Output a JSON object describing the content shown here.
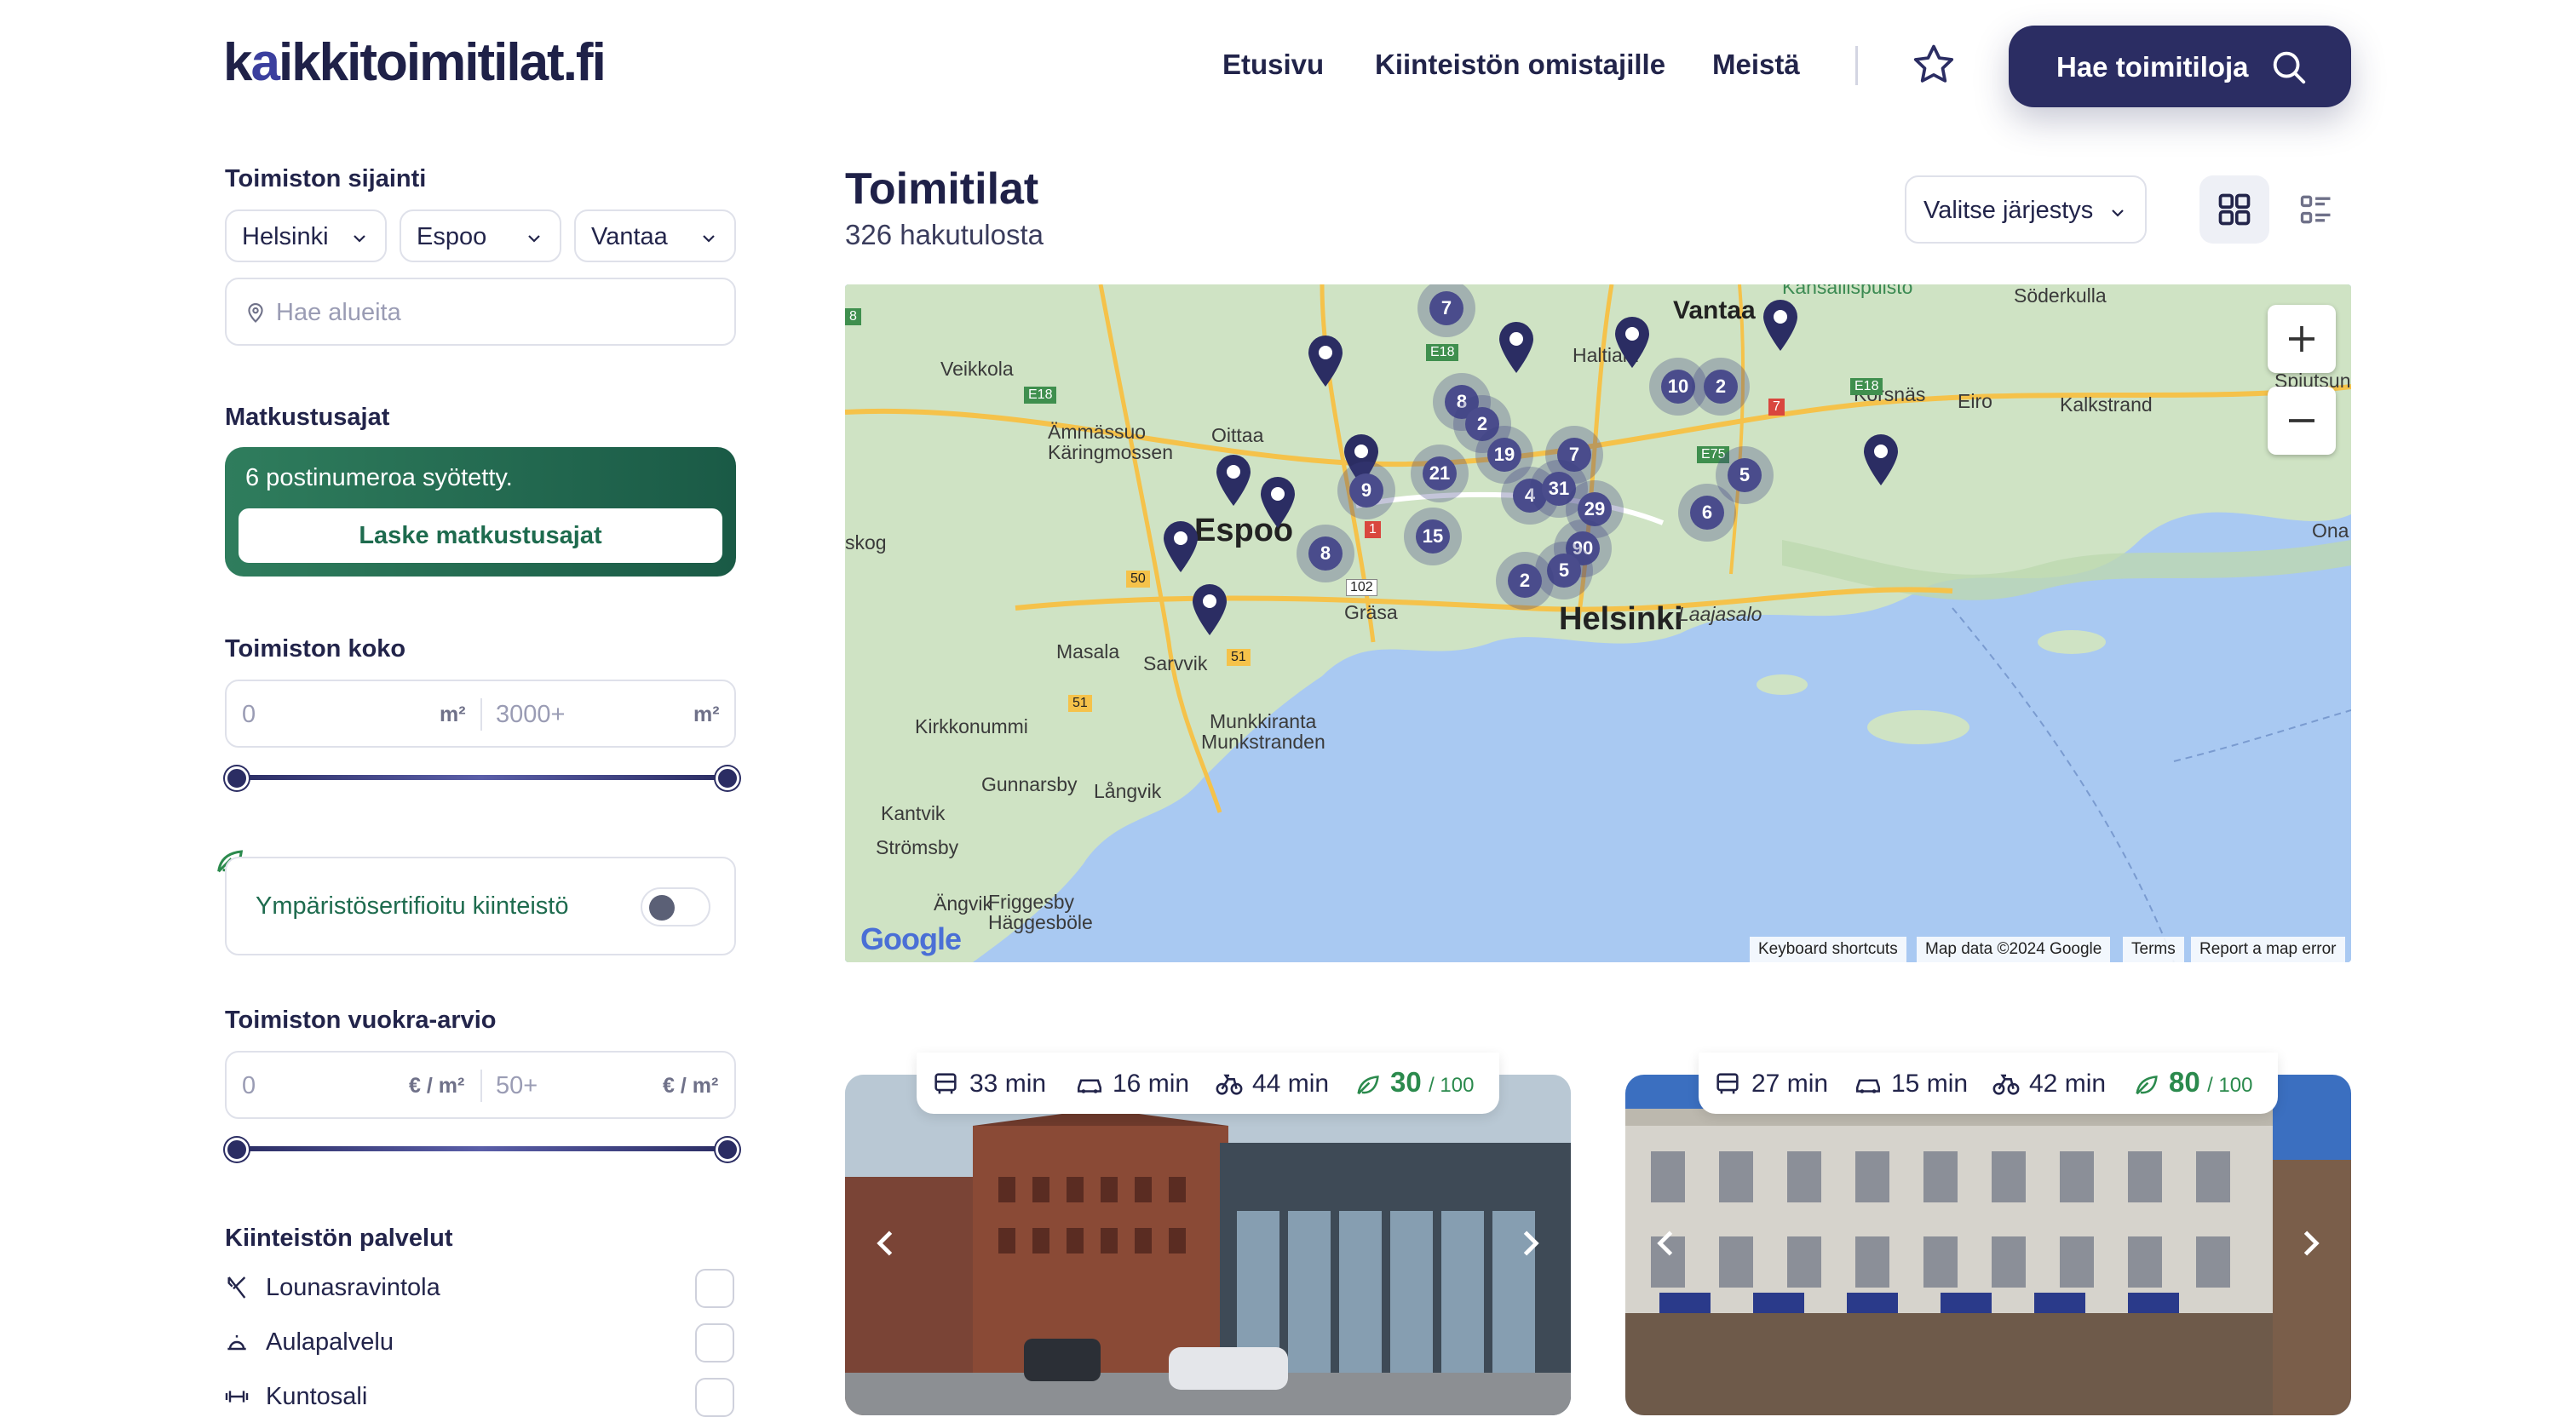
{
  "header": {
    "logo_text_pre": "k",
    "logo_text_a": "a",
    "logo_text_post": "ikkitoimitilat.fi",
    "nav": [
      "Etusivu",
      "Kiinteistön omistajille",
      "Meistä"
    ],
    "cta_label": "Hae toimitiloja"
  },
  "sidebar": {
    "location_label": "Toimiston sijainti",
    "cities": [
      "Helsinki",
      "Espoo",
      "Vantaa"
    ],
    "area_placeholder": "Hae alueita",
    "commute_label": "Matkustusajat",
    "commute_info": "6 postinumeroa syötetty.",
    "commute_button": "Laske matkustusajat",
    "size_label": "Toimiston koko",
    "size_min_placeholder": "0",
    "size_max_placeholder": "3000+",
    "size_unit": "m²",
    "eco_label": "Ympäristösertifioitu kiinteistö",
    "rent_label": "Toimiston vuokra-arvio",
    "rent_min_placeholder": "0",
    "rent_max_placeholder": "50+",
    "rent_unit": "€ / m²",
    "services_label": "Kiinteistön palvelut",
    "services": [
      "Lounasravintola",
      "Aulapalvelu",
      "Kuntosali"
    ]
  },
  "main": {
    "title": "Toimitilat",
    "result_count": "326 hakutulosta",
    "sort_label": "Valitse järjestys"
  },
  "map": {
    "place_labels": [
      "Veikkola",
      "Ämmässuo",
      "Käringmossen",
      "Oittaa",
      "Espoo",
      "Masala",
      "Sarvvik",
      "Kirkkonummi",
      "Munkkiranta",
      "Munkstranden",
      "Gunnarsby",
      "Långvik",
      "Kantvik",
      "Strömsby",
      "Ängvik",
      "Friggesby",
      "Häggesböle",
      "Gräsa",
      "Helsinki",
      "Laajasalo",
      "Vantaa",
      "Haltiala",
      "Söderkulla",
      "Korsnäs",
      "Eiro",
      "Kalkstrand",
      "Spjutsund",
      "Ona",
      "skog",
      "Kansallispuisto",
      "Kirkkonummi"
    ],
    "road_labels": [
      "E18",
      "E18",
      "E18",
      "E75",
      "50",
      "51",
      "51",
      "102",
      "1",
      "7",
      "8"
    ],
    "clusters": [
      "7",
      "8",
      "2",
      "19",
      "21",
      "9",
      "10",
      "2",
      "7",
      "5",
      "4",
      "31",
      "29",
      "6",
      "15",
      "8",
      "90",
      "5",
      "2"
    ],
    "attribution": [
      "Keyboard shortcuts",
      "Map data ©2024 Google",
      "Terms",
      "Report a map error"
    ],
    "google_label": "Google"
  },
  "listings": [
    {
      "transit": "33 min",
      "car": "16 min",
      "bike": "44 min",
      "score": "30",
      "score_max": "/ 100"
    },
    {
      "transit": "27 min",
      "car": "15 min",
      "bike": "42 min",
      "score": "80",
      "score_max": "/ 100"
    }
  ],
  "colors": {
    "brand": "#2b2d63",
    "green": "#1e6b4e",
    "map_water": "#a9c9f2",
    "map_land": "#cfe3c4"
  }
}
